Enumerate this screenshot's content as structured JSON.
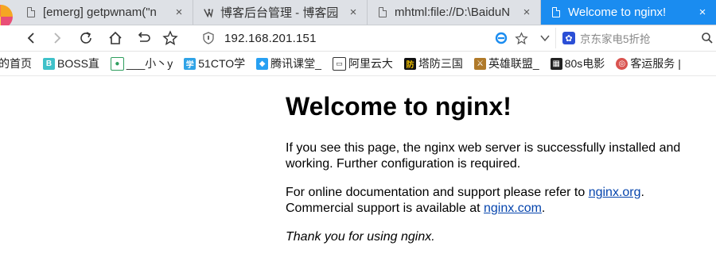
{
  "tabs": [
    {
      "title": "[emerg] getpwnam(\"n",
      "close": "×",
      "icon": "doc-icon"
    },
    {
      "title": "博客后台管理 - 博客园",
      "close": "×",
      "icon": "cnblogs-icon"
    },
    {
      "title": "mhtml:file://D:\\BaiduN",
      "close": "×",
      "icon": "doc-icon"
    },
    {
      "title": "Welcome to nginx!",
      "close": "×",
      "icon": "doc-icon",
      "active": true
    }
  ],
  "toolbar": {
    "url": "192.168.201.151",
    "search_placeholder": "京东家电5折抢"
  },
  "bookmarks": [
    {
      "label": "的首页",
      "icon": "none"
    },
    {
      "label": "BOSS直",
      "icon": "boss-icon",
      "icon_text": "B",
      "color": "#3fc1c9"
    },
    {
      "label": "___小丶y",
      "icon": "panda-icon",
      "icon_text": "🐼",
      "color": "#ffffff"
    },
    {
      "label": "51CTO学",
      "icon": "51cto-icon",
      "icon_text": "学",
      "color": "#2fa3e6"
    },
    {
      "label": "腾讯课堂_",
      "icon": "tencent-ketang-icon",
      "icon_text": "◆",
      "color": "#27a0f2"
    },
    {
      "label": "阿里云大",
      "icon": "aliyun-icon",
      "icon_text": "[-]",
      "color": "#333333"
    },
    {
      "label": "塔防三国",
      "icon": "tafang-icon",
      "icon_text": "防",
      "color": "#111111"
    },
    {
      "label": "英雄联盟_",
      "icon": "lol-icon",
      "icon_text": "⚔",
      "color": "#b07a2a"
    },
    {
      "label": "80s电影",
      "icon": "movie-icon",
      "icon_text": "🎬",
      "color": "#ffffff"
    },
    {
      "label": "客运服务 |",
      "icon": "keyun-icon",
      "icon_text": "◎",
      "color": "#d9534f"
    }
  ],
  "page": {
    "heading": "Welcome to nginx!",
    "p1": "If you see this page, the nginx web server is successfully installed and working. Further configuration is required.",
    "p2_before": "For online documentation and support please refer to ",
    "link1": "nginx.org",
    "p2_middle": ".",
    "p2_line2": "Commercial support is available at ",
    "link2": "nginx.com",
    "p2_end": ".",
    "thanks": "Thank you for using nginx."
  },
  "colors": {
    "active_tab": "#1a8cf0",
    "tab_strip": "#dee1e6",
    "link": "#0645ad"
  }
}
